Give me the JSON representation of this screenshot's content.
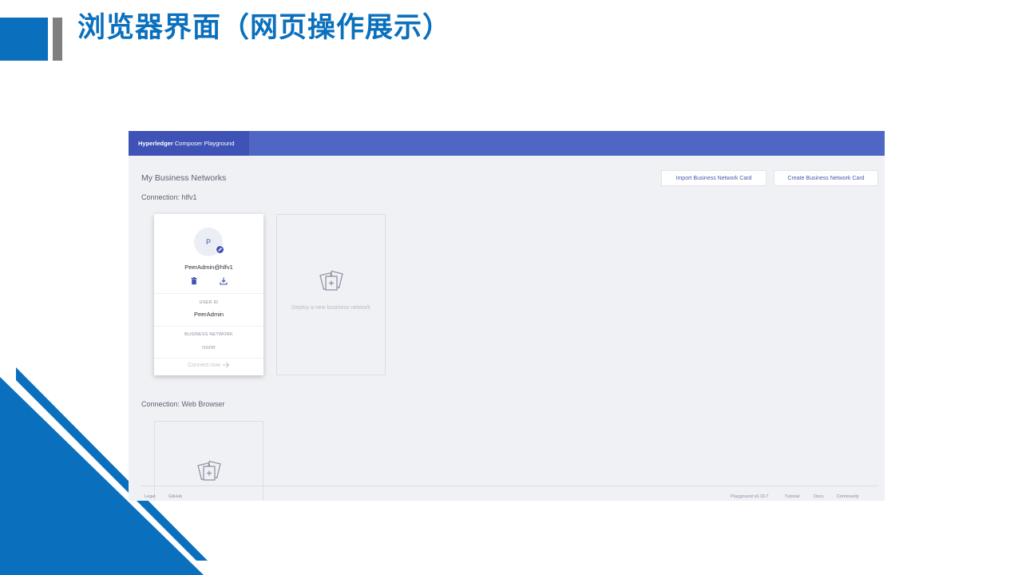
{
  "slide": {
    "title": "浏览器界面（网页操作展示）",
    "accent_color": "#0a6fbd"
  },
  "app": {
    "brand_bold": "Hyperledger",
    "brand_rest": " Composer Playground",
    "page_heading": "My Business Networks",
    "buttons": {
      "import": "Import Business Network Card",
      "create": "Create Business Network Card"
    },
    "connections": [
      {
        "label": "Connection: hlfv1",
        "card": {
          "avatar_letter": "P",
          "name": "PeerAdmin@hlfv1",
          "user_id_label": "USER ID",
          "user_id": "PeerAdmin",
          "network_label": "BUSINESS NETWORK",
          "network": "none",
          "connect_label": "Connect now"
        },
        "deploy_text": "Deploy a new business network"
      },
      {
        "label": "Connection: Web Browser"
      }
    ],
    "footer": {
      "left": [
        "Legal",
        "GitHub"
      ],
      "right": [
        "Playground v0.19.7",
        "Tutorial",
        "Docs",
        "Community"
      ]
    },
    "colors": {
      "header": "#5066c4",
      "brand": "#3e53b5",
      "background": "#f0f1f5"
    }
  }
}
